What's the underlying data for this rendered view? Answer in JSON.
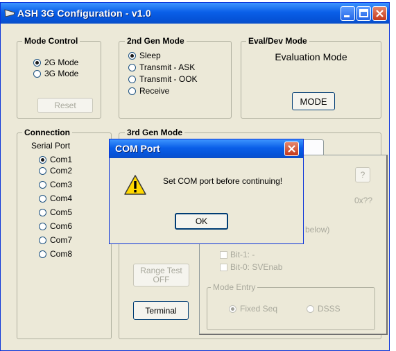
{
  "window": {
    "title": "ASH 3G Configuration - v1.0",
    "controls": {
      "minimize_icon": "minimize-icon",
      "maximize_icon": "maximize-icon",
      "close_icon": "close-icon"
    }
  },
  "mode_control": {
    "label": "Mode Control",
    "options": [
      "2G Mode",
      "3G Mode"
    ],
    "selected": "2G Mode",
    "reset_label": "Reset"
  },
  "gen2_mode": {
    "label": "2nd Gen Mode",
    "options": [
      "Sleep",
      "Transmit - ASK",
      "Transmit - OOK",
      "Receive"
    ],
    "selected": "Sleep"
  },
  "eval_dev": {
    "label": "Eval/Dev Mode",
    "mode_text": "Evaluation Mode",
    "mode_button": "MODE"
  },
  "connection": {
    "label": "Connection",
    "serial_port_label": "Serial Port",
    "ports": [
      "Com1",
      "Com2",
      "Com3",
      "Com4",
      "Com5",
      "Com6",
      "Com7",
      "Com8"
    ],
    "selected": "Com1"
  },
  "gen3_mode": {
    "label": "3rd Gen Mode",
    "help_button": "?",
    "hex_value": "0x??",
    "partial_text": "below)",
    "bit1": "Bit-1: -",
    "bit0": "Bit-0: SVEnab",
    "range_test": {
      "line1": "Range Test",
      "line2": "OFF"
    },
    "terminal_label": "Terminal",
    "mode_entry": {
      "label": "Mode Entry",
      "options": [
        "Fixed Seq",
        "DSSS"
      ],
      "selected": "Fixed Seq"
    }
  },
  "dialog": {
    "title": "COM Port",
    "message": "Set COM port before continuing!",
    "ok_label": "OK",
    "icon": "warning-icon"
  },
  "colors": {
    "titlebar": "#0A5FE8",
    "window_bg": "#ECE9D8",
    "close_red": "#C4391C"
  }
}
